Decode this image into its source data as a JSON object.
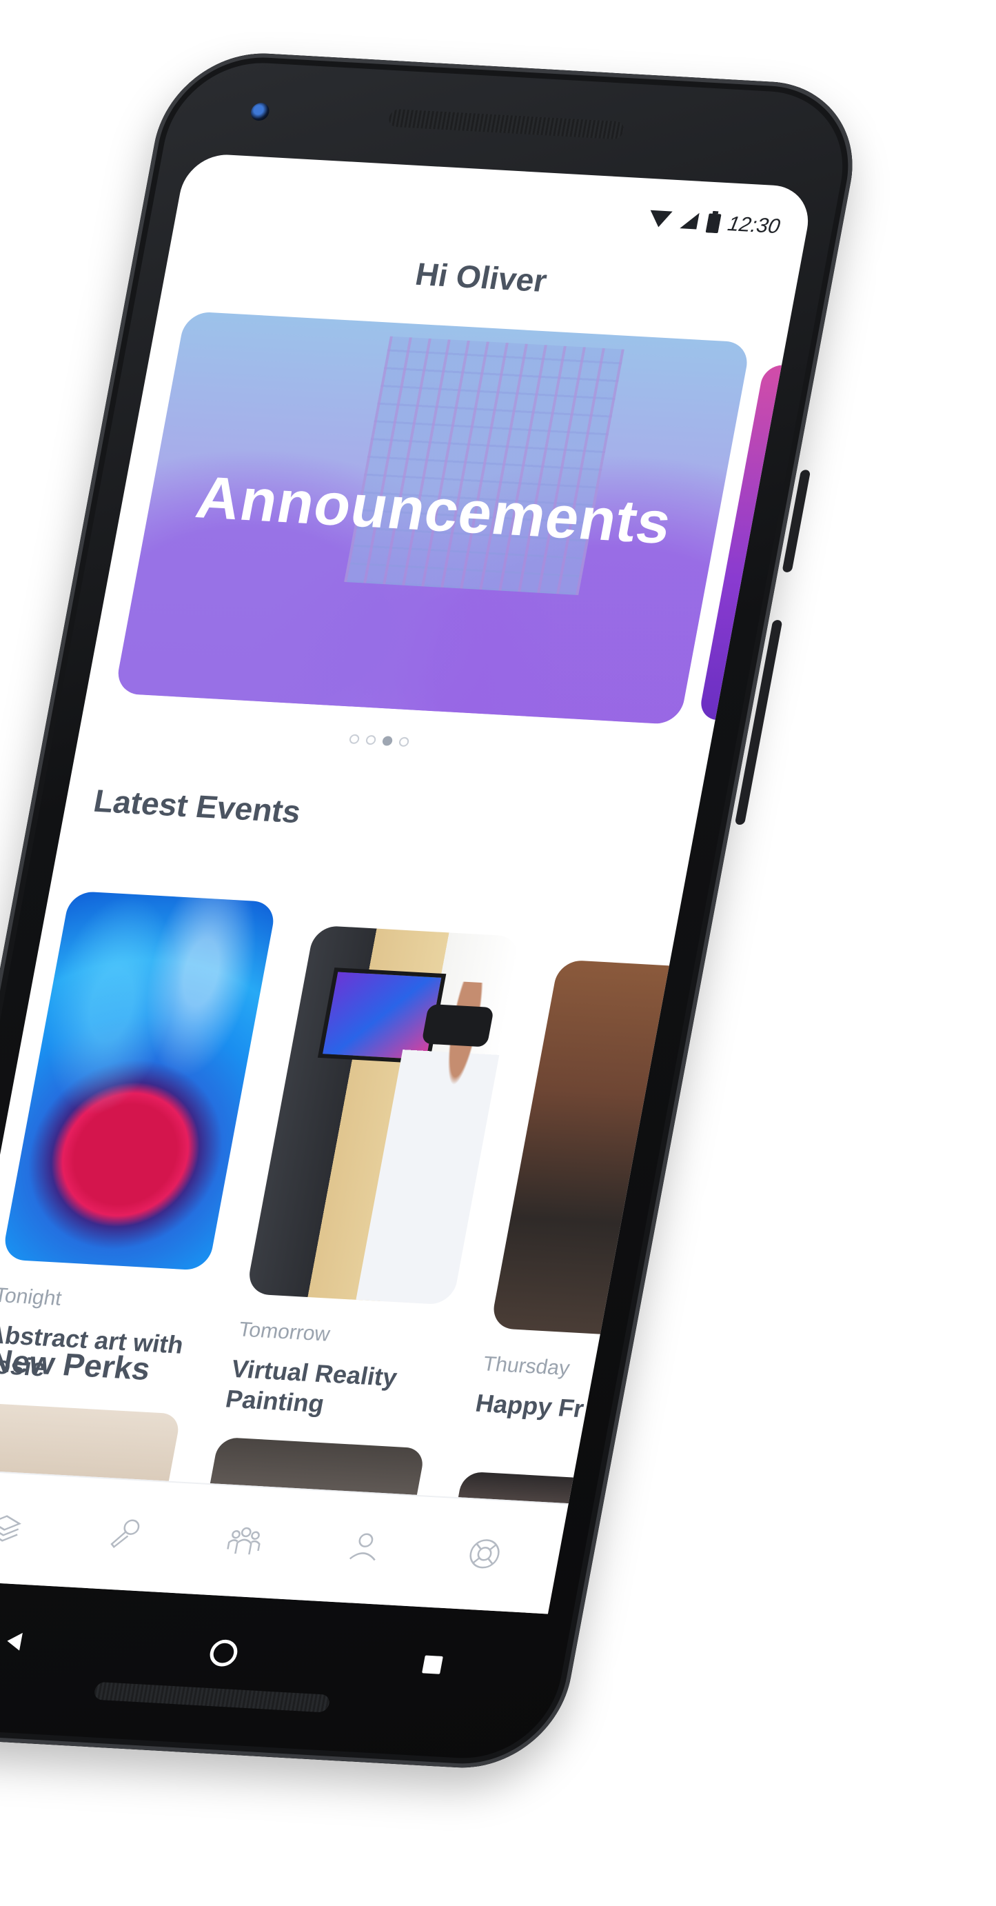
{
  "status_bar": {
    "time": "12:30",
    "icons": [
      "wifi-icon",
      "signal-icon",
      "battery-icon"
    ]
  },
  "header": {
    "greeting": "Hi Oliver"
  },
  "hero": {
    "title": "Announcements",
    "pager": {
      "count": 4,
      "active_index": 2
    }
  },
  "events": {
    "section_title": "Latest Events",
    "items": [
      {
        "when": "Tonight",
        "title": "Abstract art with Josie"
      },
      {
        "when": "Tomorrow",
        "title": "Virtual Reality Painting"
      },
      {
        "when": "Thursday",
        "title": "Happy Fr"
      }
    ]
  },
  "perks": {
    "section_title": "New Perks"
  },
  "tab_bar": {
    "tabs": [
      "feed-icon",
      "microphone-icon",
      "community-icon",
      "profile-icon",
      "help-icon"
    ]
  },
  "system_nav": {
    "buttons": [
      "back-icon",
      "home-icon",
      "recents-icon"
    ]
  },
  "colors": {
    "heading": "#4b5461",
    "muted": "#9aa3ae",
    "hero_gradient_top": "#9cc2ea",
    "hero_gradient_bottom": "#a87fe8",
    "phone_body": "#111214"
  }
}
